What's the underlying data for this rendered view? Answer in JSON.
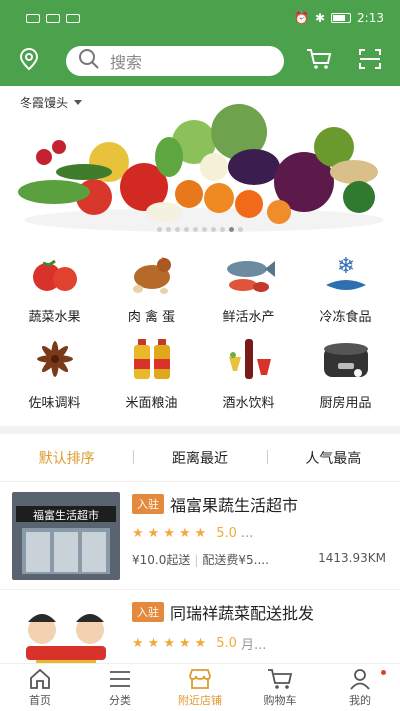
{
  "status": {
    "time": "2:13"
  },
  "header": {
    "search_placeholder": "搜索"
  },
  "location": {
    "city": "冬霞馒头"
  },
  "categories": [
    {
      "label": "蔬菜水果",
      "icon": "tomato-icon"
    },
    {
      "label": "肉 禽 蛋",
      "icon": "chicken-icon"
    },
    {
      "label": "鲜活水产",
      "icon": "fish-icon"
    },
    {
      "label": "冷冻食品",
      "icon": "snowflake-fish-icon"
    },
    {
      "label": "佐味调料",
      "icon": "star-anise-icon"
    },
    {
      "label": "米面粮油",
      "icon": "oil-bottle-icon"
    },
    {
      "label": "酒水饮料",
      "icon": "drinks-icon"
    },
    {
      "label": "厨房用品",
      "icon": "rice-cooker-icon"
    }
  ],
  "sort": {
    "default": "默认排序",
    "distance": "距离最近",
    "popular": "人气最高"
  },
  "shops": [
    {
      "tag": "入驻",
      "name": "福富果蔬生活超市",
      "score": "5.0",
      "more": "...",
      "min_order": "¥10.0起送",
      "delivery": "配送费¥5....",
      "distance": "1413.93KM",
      "sign_text": "福富生活超市"
    },
    {
      "tag": "入驻",
      "name": "同瑞祥蔬菜配送批发",
      "score": "5.0",
      "more": "月..."
    }
  ],
  "tabs": {
    "home": "首页",
    "category": "分类",
    "nearby": "附近店铺",
    "cart": "购物车",
    "mine": "我的"
  },
  "colors": {
    "primary": "#4ca24c",
    "accent": "#e09a2e",
    "tag": "#e58a3c"
  }
}
